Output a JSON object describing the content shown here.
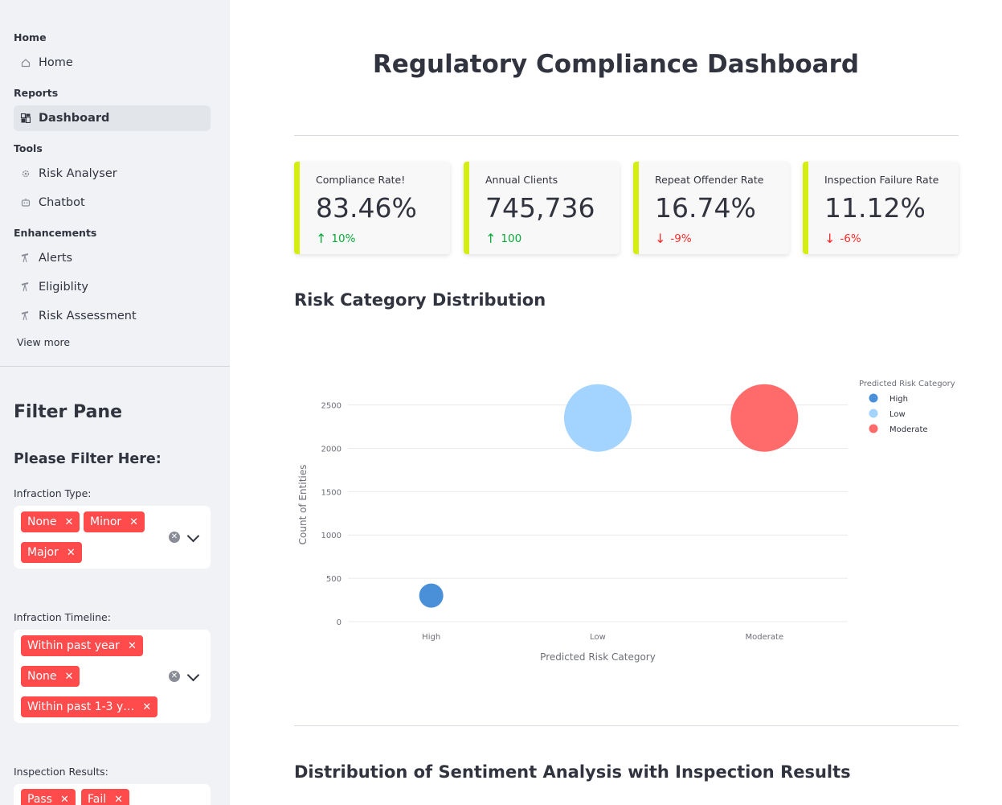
{
  "sidebar": {
    "sections": [
      {
        "label": "Home",
        "items": [
          {
            "label": "Home",
            "icon": "home-icon"
          }
        ]
      },
      {
        "label": "Reports",
        "items": [
          {
            "label": "Dashboard",
            "icon": "dashboard-icon",
            "active": true
          }
        ]
      },
      {
        "label": "Tools",
        "items": [
          {
            "label": "Risk Analyser",
            "icon": "gear-icon"
          },
          {
            "label": "Chatbot",
            "icon": "robot-icon"
          }
        ]
      },
      {
        "label": "Enhancements",
        "items": [
          {
            "label": "Alerts",
            "icon": "telescope-icon"
          },
          {
            "label": "Eligiblity",
            "icon": "telescope-icon"
          },
          {
            "label": "Risk Assessment",
            "icon": "telescope-icon"
          }
        ]
      }
    ],
    "view_more": "View more"
  },
  "filters": {
    "title": "Filter Pane",
    "subtitle": "Please Filter Here:",
    "infraction_type": {
      "label": "Infraction Type:",
      "tags": [
        "None",
        "Minor",
        "Major"
      ]
    },
    "infraction_timeline": {
      "label": "Infraction Timeline:",
      "tags": [
        "Within past year",
        "None",
        "Within past 1-3 y…"
      ]
    },
    "inspection_results": {
      "label": "Inspection Results:",
      "tags": [
        "Pass",
        "Fail"
      ]
    }
  },
  "main": {
    "title": "Regulatory Compliance Dashboard",
    "kpis": [
      {
        "label": "Compliance Rate!",
        "value": "83.46%",
        "delta": "10%",
        "direction": "up"
      },
      {
        "label": "Annual Clients",
        "value": "745,736",
        "delta": "100",
        "direction": "up"
      },
      {
        "label": "Repeat Offender Rate",
        "value": "16.74%",
        "delta": "-9%",
        "direction": "down"
      },
      {
        "label": "Inspection Failure Rate",
        "value": "11.12%",
        "delta": "-6%",
        "direction": "down"
      }
    ],
    "section1_title": "Risk Category Distribution",
    "section2_title": "Distribution of Sentiment Analysis with Inspection Results"
  },
  "colors": {
    "accent": "#ff4b4b",
    "kpi_border": "#d5ee12",
    "up": "#09ab3b",
    "down": "#ff2b2b"
  },
  "chart_data": {
    "type": "scatter",
    "xlabel": "Predicted Risk Category",
    "ylabel": "Count of Entities",
    "categories": [
      "High",
      "Low",
      "Moderate"
    ],
    "yticks": [
      0,
      500,
      1000,
      1500,
      2000,
      2500
    ],
    "ylim": [
      0,
      2700
    ],
    "grid": true,
    "legend_title": "Predicted Risk Category",
    "legend_position": "right",
    "series": [
      {
        "name": "High",
        "x": "High",
        "y": 300,
        "color": "#4a90d9"
      },
      {
        "name": "Low",
        "x": "Low",
        "y": 2350,
        "color": "#a3d4ff"
      },
      {
        "name": "Moderate",
        "x": "Moderate",
        "y": 2350,
        "color": "#ff6b6b"
      }
    ]
  }
}
